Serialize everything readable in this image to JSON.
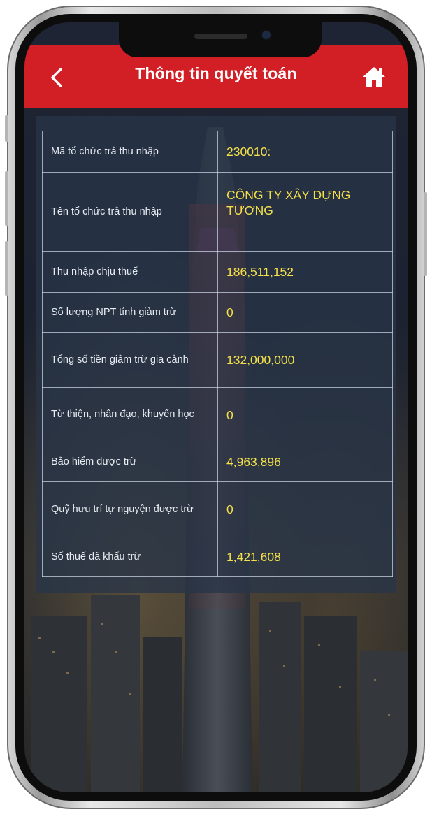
{
  "header": {
    "title": "Thông tin quyết toán",
    "back_icon": "chevron-left-icon",
    "home_icon": "home-icon"
  },
  "colors": {
    "header_bg": "#d21f26",
    "label_text": "#e8ecf2",
    "value_text": "#f3e04a"
  },
  "rows": [
    {
      "label": "Mã tổ chức trả thu nhập",
      "value": "230010:"
    },
    {
      "label": "Tên tổ chức trả thu nhập",
      "value": "CÔNG TY XÂY DỰNG TƯƠNG"
    },
    {
      "label": "Thu nhập chịu thuế",
      "value": "186,511,152"
    },
    {
      "label": "Số lượng NPT tính giảm trừ",
      "value": "0"
    },
    {
      "label": "Tổng số tiền giảm trừ gia cảnh",
      "value": "132,000,000"
    },
    {
      "label": "Từ thiện, nhân đạo, khuyến học",
      "value": "0"
    },
    {
      "label": "Bảo hiểm được trừ",
      "value": "4,963,896"
    },
    {
      "label": "Quỹ hưu trí tự nguyện được trừ",
      "value": "0"
    },
    {
      "label": "Số thuế đã khấu trừ",
      "value": "1,421,608"
    }
  ]
}
